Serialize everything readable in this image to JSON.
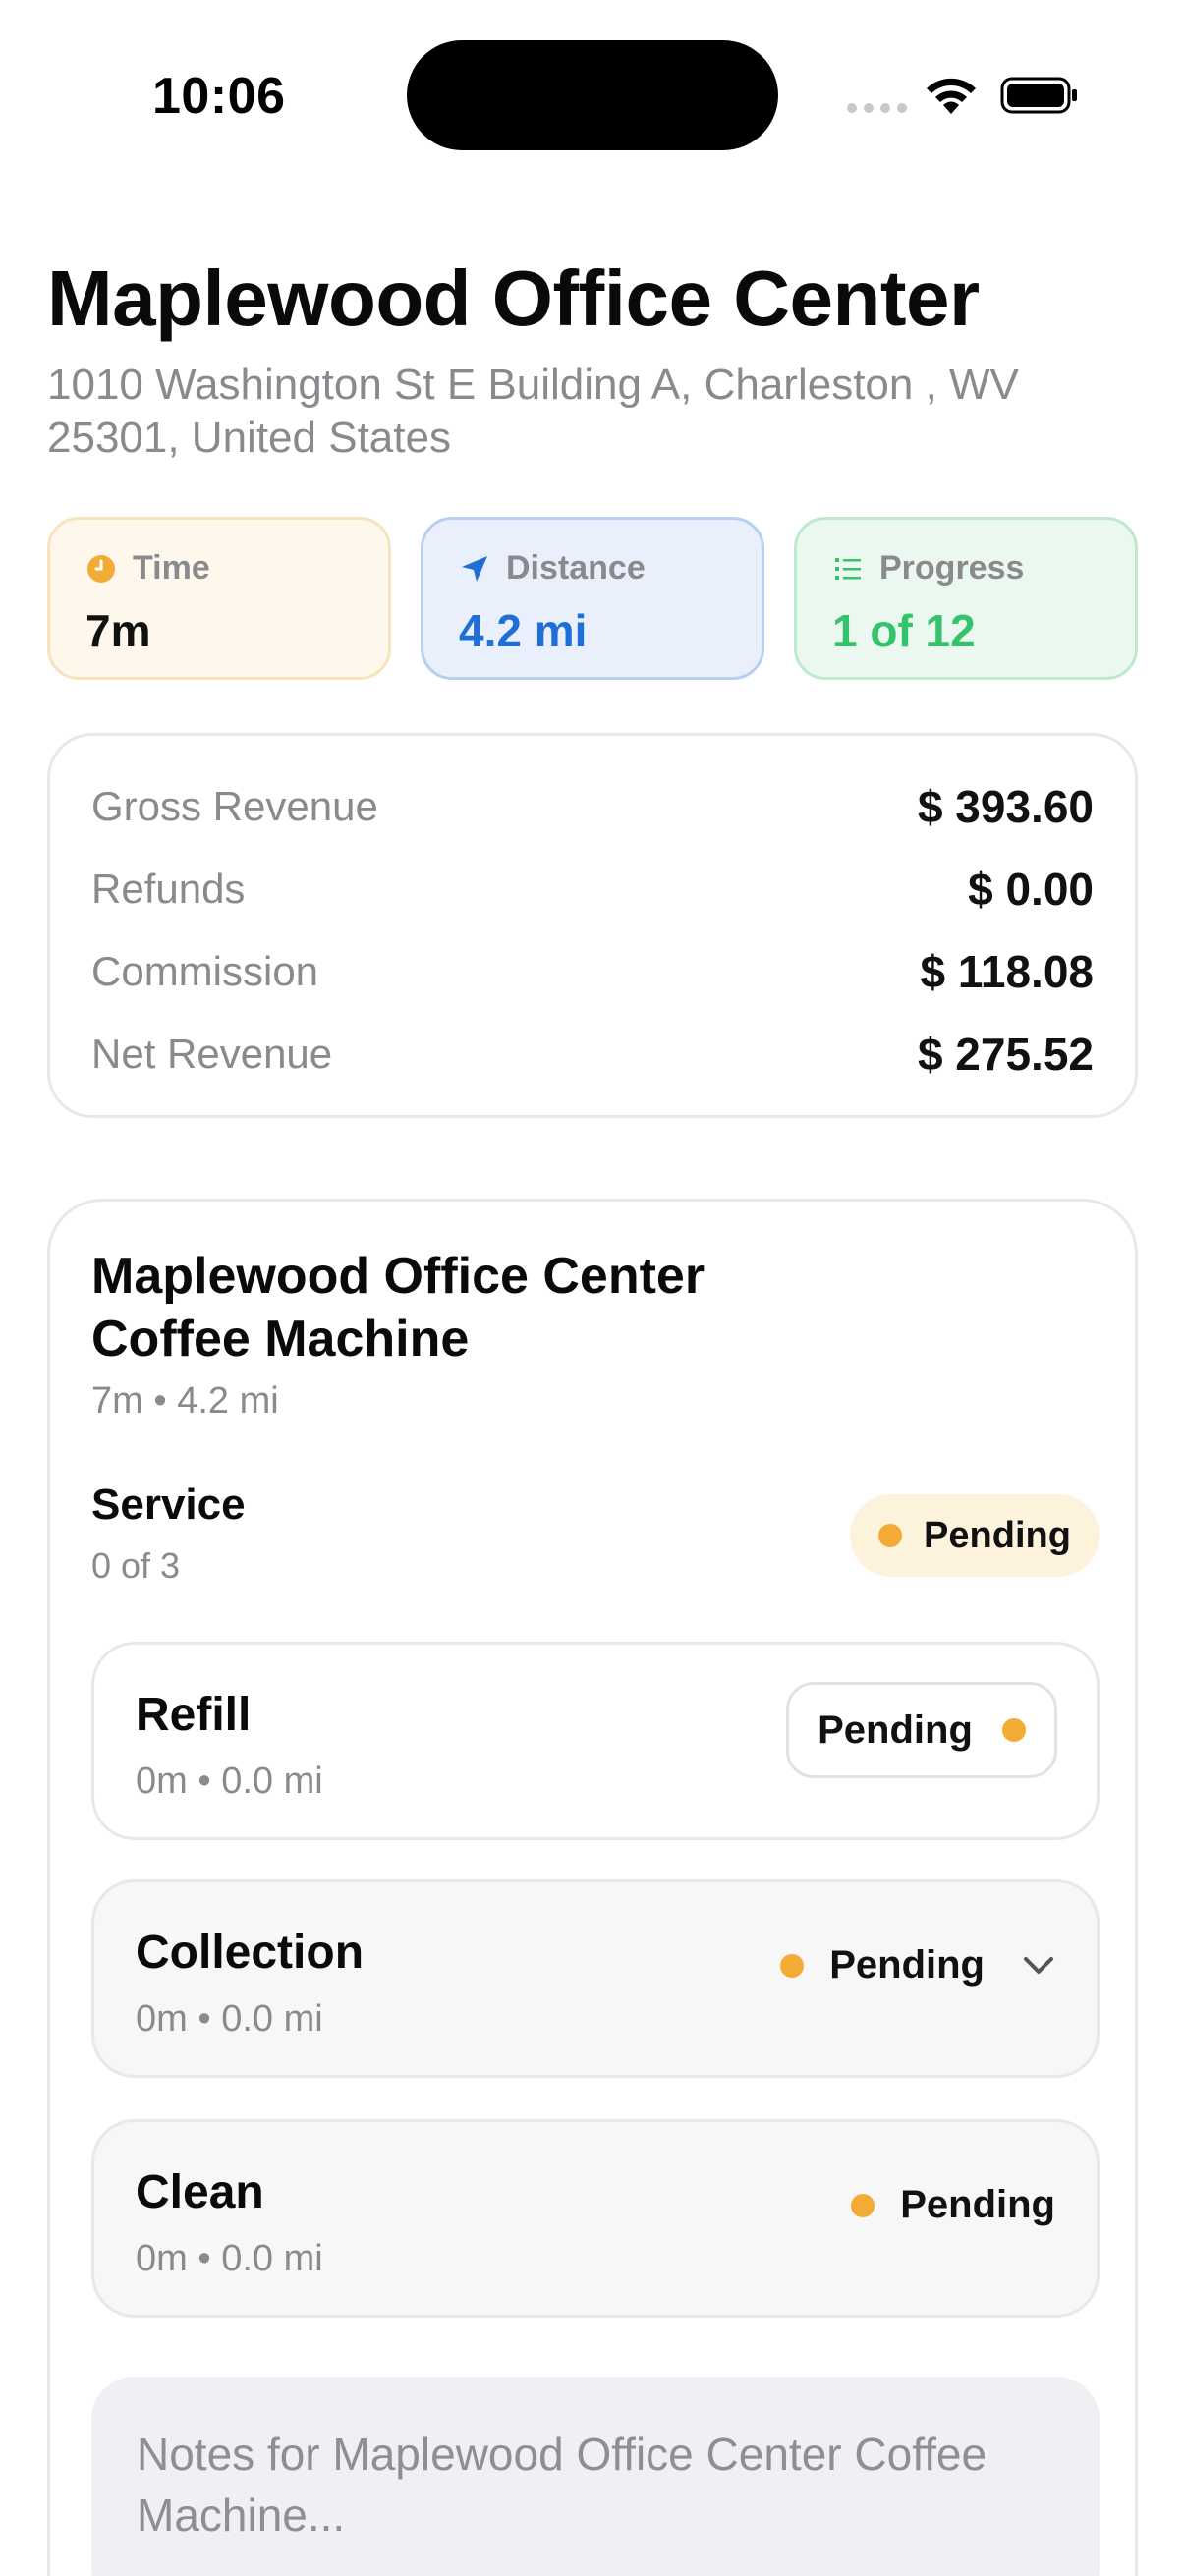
{
  "status_bar": {
    "time": "10:06"
  },
  "header": {
    "title": "Maplewood Office Center",
    "address": "1010 Washington St E Building A, Charleston , WV 25301, United States"
  },
  "stats": {
    "time": {
      "label": "Time",
      "value": "7m",
      "icon": "clock-icon",
      "color": "#f2ab34"
    },
    "distance": {
      "label": "Distance",
      "value": "4.2 mi",
      "icon": "navigation-arrow-icon",
      "color": "#1f6fd8"
    },
    "progress": {
      "label": "Progress",
      "value": "1 of 12",
      "icon": "list-icon",
      "color": "#34c36a"
    }
  },
  "revenue": {
    "rows": [
      {
        "label": "Gross Revenue",
        "value": "$ 393.60"
      },
      {
        "label": "Refunds",
        "value": "$ 0.00"
      },
      {
        "label": "Commission",
        "value": "$ 118.08"
      },
      {
        "label": "Net Revenue",
        "value": "$ 275.52"
      }
    ]
  },
  "machine": {
    "title": "Maplewood Office Center Coffee Machine",
    "meta": "7m • 4.2 mi",
    "service_label": "Service",
    "service_count": "0 of 3",
    "service_status": "Pending",
    "tasks": [
      {
        "name": "Refill",
        "meta": "0m • 0.0 mi",
        "status": "Pending"
      },
      {
        "name": "Collection",
        "meta": "0m • 0.0 mi",
        "status": "Pending"
      },
      {
        "name": "Clean",
        "meta": "0m • 0.0 mi",
        "status": "Pending"
      }
    ],
    "notes_placeholder": "Notes for Maplewood Office Center Coffee Machine..."
  },
  "colors": {
    "pending": "#f2ab34",
    "accent_blue": "#1f6fd8",
    "accent_green": "#34c36a"
  }
}
